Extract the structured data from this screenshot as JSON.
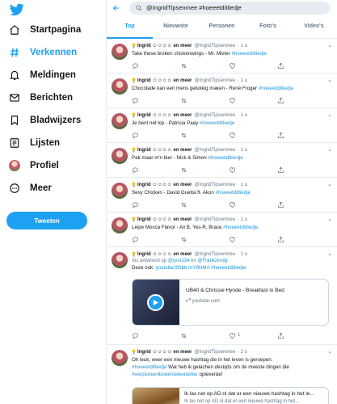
{
  "brand_color": "#1da1f2",
  "sidebar": {
    "items": [
      {
        "label": "Startpagina",
        "icon": "home-icon"
      },
      {
        "label": "Verkennen",
        "icon": "hashtag-icon"
      },
      {
        "label": "Meldingen",
        "icon": "bell-icon"
      },
      {
        "label": "Berichten",
        "icon": "envelope-icon"
      },
      {
        "label": "Bladwijzers",
        "icon": "bookmark-icon"
      },
      {
        "label": "Lijsten",
        "icon": "list-icon"
      },
      {
        "label": "Profiel",
        "icon": "avatar"
      },
      {
        "label": "Meer",
        "icon": "more-icon"
      }
    ],
    "tweet_button": "Tweeten"
  },
  "search": {
    "query": "@IngridTipsenmee #hoeeetditliedje"
  },
  "tabs": [
    "Top",
    "Nieuwste",
    "Personen",
    "Foto's",
    "Video's"
  ],
  "tweets": [
    {
      "name": "Ingrid ☺☺☺☺ en meer",
      "handle": "@IngridTipsenmee",
      "time": "· 1 u",
      "text": "Take these broken chickenwings - Mr. Mister ",
      "tag": "#hoeeetditliedje"
    },
    {
      "name": "Ingrid ☺☺☺☺ en meer",
      "handle": "@IngridTipsenmee",
      "time": "· 1 u",
      "text": "Chocolade kan een mens gelukkig maken - René Froger ",
      "tag": "#hoeeetditliedje"
    },
    {
      "name": "Ingrid ☺☺☺☺ en meer",
      "handle": "@IngridTipsenmee",
      "time": "· 1 u",
      "text": "Je bent net kip - Patricia Paay ",
      "tag": "#hoeeetditliedje"
    },
    {
      "name": "Ingrid ☺☺☺☺ en meer",
      "handle": "@IngridTipsenmee",
      "time": "· 1 u",
      "text": "Pak maar m'n bier - Nick & Simon ",
      "tag": "#hoeeetditliedje"
    },
    {
      "name": "Ingrid ☺☺☺☺ en meer",
      "handle": "@IngridTipsenmee",
      "time": "· 1 u",
      "text": "Sexy Chicken - David Guetta ft. Akon ",
      "tag": "#hoeeetditliedje"
    },
    {
      "name": "Ingrid ☺☺☺☺ en meer",
      "handle": "@IngridTipsenmee",
      "time": "· 1 u",
      "text": "Leipe Mocca Flavor - Ali B, Yes-R, Brace ",
      "tag": "#hoeeetditliedje"
    }
  ],
  "tweet7": {
    "name": "Ingrid ☺☺☺☺ en meer",
    "handle": "@IngridTipsenmee",
    "time": "· 1 u",
    "reply_prefix": "Als antwoord op ",
    "reply_user1": "@lynx234",
    "reply_and": " en ",
    "reply_user2": "@Frankzinnig",
    "text": "Deze ook: ",
    "link": "youtube/3Obb.mY8NMA",
    "tag": "#hoeeetditliedje",
    "card_title": "UB40 & Chrissie Hynde - Breakfast in Bed",
    "card_domain": "youtube.com",
    "like_count": "1"
  },
  "tweet8": {
    "name": "Ingrid ☺☺☺☺ en meer",
    "handle": "@IngridTipsenmee",
    "time": "· 2 u",
    "line1": "Oh leuk, weer een nieuwe hashtag die in het leven is geroepen:",
    "tag1": "#hoeeetditliedje",
    "line2": " Wat heb ik gelachen destijds om de meeste dingen die",
    "tag2": "#verpesteenboekmeteenletter",
    "line3": " opleverde!",
    "card_title": "Ik las net op AD.nl dat er een nieuwe hashtag in het le...",
    "card_sub": "Ik las net op AD.nl dat er een nieuwe hashtag in het..."
  }
}
